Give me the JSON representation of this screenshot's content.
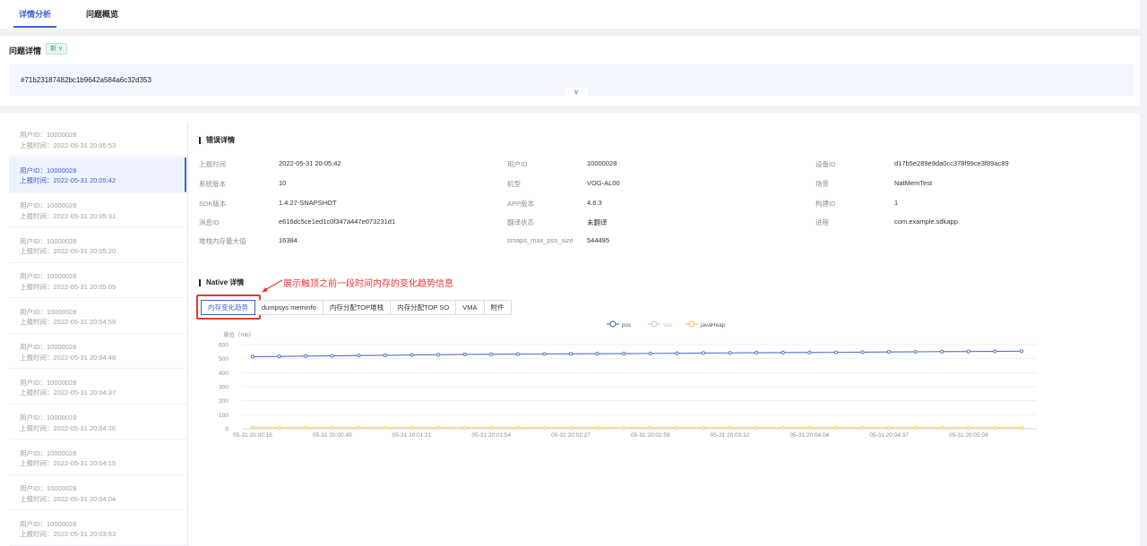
{
  "tabs": [
    {
      "label": "详情分析",
      "active": true
    },
    {
      "label": "问题概览",
      "active": false
    }
  ],
  "issue": {
    "title": "问题详情",
    "status": "新",
    "hash": "#71b23187482bc1b9642a584a6c32d353"
  },
  "reports": [
    {
      "user": "用户ID：10000028",
      "time": "上报时间：2022-05-31 20:05:53"
    },
    {
      "user": "用户ID：10000028",
      "time": "上报时间：2022-05-31 20:05:42",
      "active": true
    },
    {
      "user": "用户ID：10000028",
      "time": "上报时间：2022-05-31 20:05:31"
    },
    {
      "user": "用户ID：10000028",
      "time": "上报时间：2022-05-31 20:05:20"
    },
    {
      "user": "用户ID：10000028",
      "time": "上报时间：2022-05-31 20:05:09"
    },
    {
      "user": "用户ID：10000028",
      "time": "上报时间：2022-05-31 20:04:59"
    },
    {
      "user": "用户ID：10000028",
      "time": "上报时间：2022-05-31 20:04:48"
    },
    {
      "user": "用户ID：10000028",
      "time": "上报时间：2022-05-31 20:04:37"
    },
    {
      "user": "用户ID：10000028",
      "time": "上报时间：2022-05-31 20:04:26"
    },
    {
      "user": "用户ID：10000028",
      "time": "上报时间：2022-05-31 20:04:15"
    },
    {
      "user": "用户ID：10000028",
      "time": "上报时间：2022-05-31 20:04:04"
    },
    {
      "user": "用户ID：10000028",
      "time": "上报时间：2022-05-31 20:03:53"
    }
  ],
  "error_detail": {
    "title": "错误详情",
    "fields": {
      "report_time": {
        "label": "上报时间",
        "value": "2022-05-31 20:05:42"
      },
      "user_id": {
        "label": "用户ID",
        "value": "10000028"
      },
      "device_id": {
        "label": "设备ID",
        "value": "d17b5e289e9da0cc378f99ce3f89ac89"
      },
      "os_version": {
        "label": "系统版本",
        "value": "10"
      },
      "model": {
        "label": "机型",
        "value": "VOG-AL00"
      },
      "scene": {
        "label": "场景",
        "value": "NatMemTest"
      },
      "sdk_version": {
        "label": "SDK版本",
        "value": "1.4.27-SNAPSHOT"
      },
      "app_version": {
        "label": "APP版本",
        "value": "4.6.3"
      },
      "build_id": {
        "label": "构建ID",
        "value": "1"
      },
      "message_id": {
        "label": "消息ID",
        "value": "e616dc5ce1ed1c0f347a447e073231d1"
      },
      "translate_status": {
        "label": "翻译状态",
        "value": "未翻译"
      },
      "process": {
        "label": "进程",
        "value": "com.example.sdkapp"
      },
      "heap_max": {
        "label": "堆栈内存最大值",
        "value": "16384"
      },
      "smaps": {
        "label": "smaps_max_pss_size",
        "value": "544495"
      }
    }
  },
  "native": {
    "title": "Native 详情",
    "annotation": "展示触顶之前一段时间内存的变化趋势信息",
    "subtabs": [
      "内存变化趋势",
      "dumpsys meminfo",
      "内存分配TOP堆栈",
      "内存分配TOP SO",
      "VMA",
      "附件"
    ],
    "active_subtab": 0
  },
  "chart_data": {
    "type": "line",
    "ylabel": "单位（mb）",
    "ylim": [
      0,
      600
    ],
    "yticks": [
      0,
      100,
      200,
      300,
      400,
      500,
      600
    ],
    "xtick_labels": [
      "05-31 20:00:16",
      "05-31 20:00:49",
      "05-31 20:01:21",
      "05-31 20:01:54",
      "05-31 20:02:27",
      "05-31 20:02:59",
      "05-31 20:03:32",
      "05-31 20:04:04",
      "05-31 20:04:37",
      "05-31 20:05:09"
    ],
    "point_count": 30,
    "legend_position": "top-center",
    "grid": true,
    "series": [
      {
        "name": "pss",
        "color": "#5470c6",
        "visible": true,
        "values": [
          514,
          516,
          518,
          520,
          522,
          524,
          526,
          528,
          530,
          531,
          532,
          533,
          534,
          535,
          536,
          537,
          538,
          540,
          541,
          542,
          543,
          544,
          545,
          546,
          548,
          549,
          550,
          551,
          552,
          553
        ]
      },
      {
        "name": "vss",
        "color": "#cccccc",
        "visible": false,
        "values": []
      },
      {
        "name": "javaHeap",
        "color": "#fac858",
        "visible": true,
        "values": [
          8,
          8,
          8,
          8,
          8,
          8,
          8,
          8,
          8,
          8,
          8,
          8,
          8,
          8,
          8,
          8,
          8,
          8,
          8,
          8,
          8,
          8,
          8,
          8,
          8,
          8,
          8,
          8,
          8,
          8
        ]
      }
    ]
  }
}
